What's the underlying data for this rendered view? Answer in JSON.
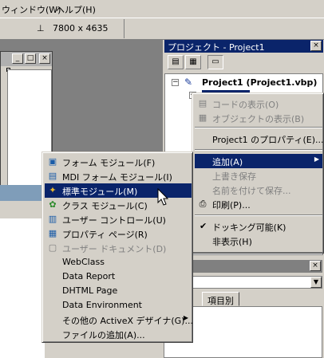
{
  "menubar": {
    "items": [
      {
        "label": "ウィンドウ(W)"
      },
      {
        "label": "ヘルプ(H)"
      }
    ]
  },
  "toolbar": {
    "size_readout": "7800 x 4635"
  },
  "project_explorer": {
    "title": "プロジェクト - Project1",
    "close": "×",
    "tree_root": "Project1 (Project1.vbp)",
    "minus": "−"
  },
  "project_context_menu": {
    "items": [
      {
        "label": "コードの表示(O)",
        "disabled": true
      },
      {
        "label": "オブジェクトの表示(B)",
        "disabled": true
      },
      {
        "label": "Project1 のプロパティ(E)...",
        "disabled": false
      },
      {
        "label": "追加(A)",
        "disabled": false,
        "highlighted": true
      },
      {
        "label": "上書き保存",
        "disabled": true
      },
      {
        "label": "名前を付けて保存...",
        "disabled": true
      },
      {
        "label": "印刷(P)...",
        "disabled": false
      },
      {
        "label": "ドッキング可能(K)",
        "disabled": false,
        "checked": true
      },
      {
        "label": "非表示(H)",
        "disabled": false
      }
    ]
  },
  "add_submenu": {
    "items": [
      {
        "label": "フォーム モジュール(F)",
        "icon": "form-icon"
      },
      {
        "label": "MDI フォーム モジュール(I)",
        "icon": "mdi-form-icon"
      },
      {
        "label": "標準モジュール(M)",
        "icon": "module-icon",
        "highlighted": true
      },
      {
        "label": "クラス モジュール(C)",
        "icon": "class-module-icon"
      },
      {
        "label": "ユーザー コントロール(U)",
        "icon": "user-control-icon"
      },
      {
        "label": "プロパティ ページ(R)",
        "icon": "property-page-icon"
      },
      {
        "label": "ユーザー ドキュメント(D)",
        "icon": "user-document-icon",
        "disabled": true
      },
      {
        "label": "WebClass"
      },
      {
        "label": "Data Report"
      },
      {
        "label": "DHTML Page"
      },
      {
        "label": "Data Environment"
      },
      {
        "label": "その他の ActiveX デザイナ(G)...",
        "submenu": true
      },
      {
        "label": "ファイルの追加(A)..."
      }
    ]
  },
  "properties": {
    "tab_category": "項目別",
    "close": "×"
  }
}
